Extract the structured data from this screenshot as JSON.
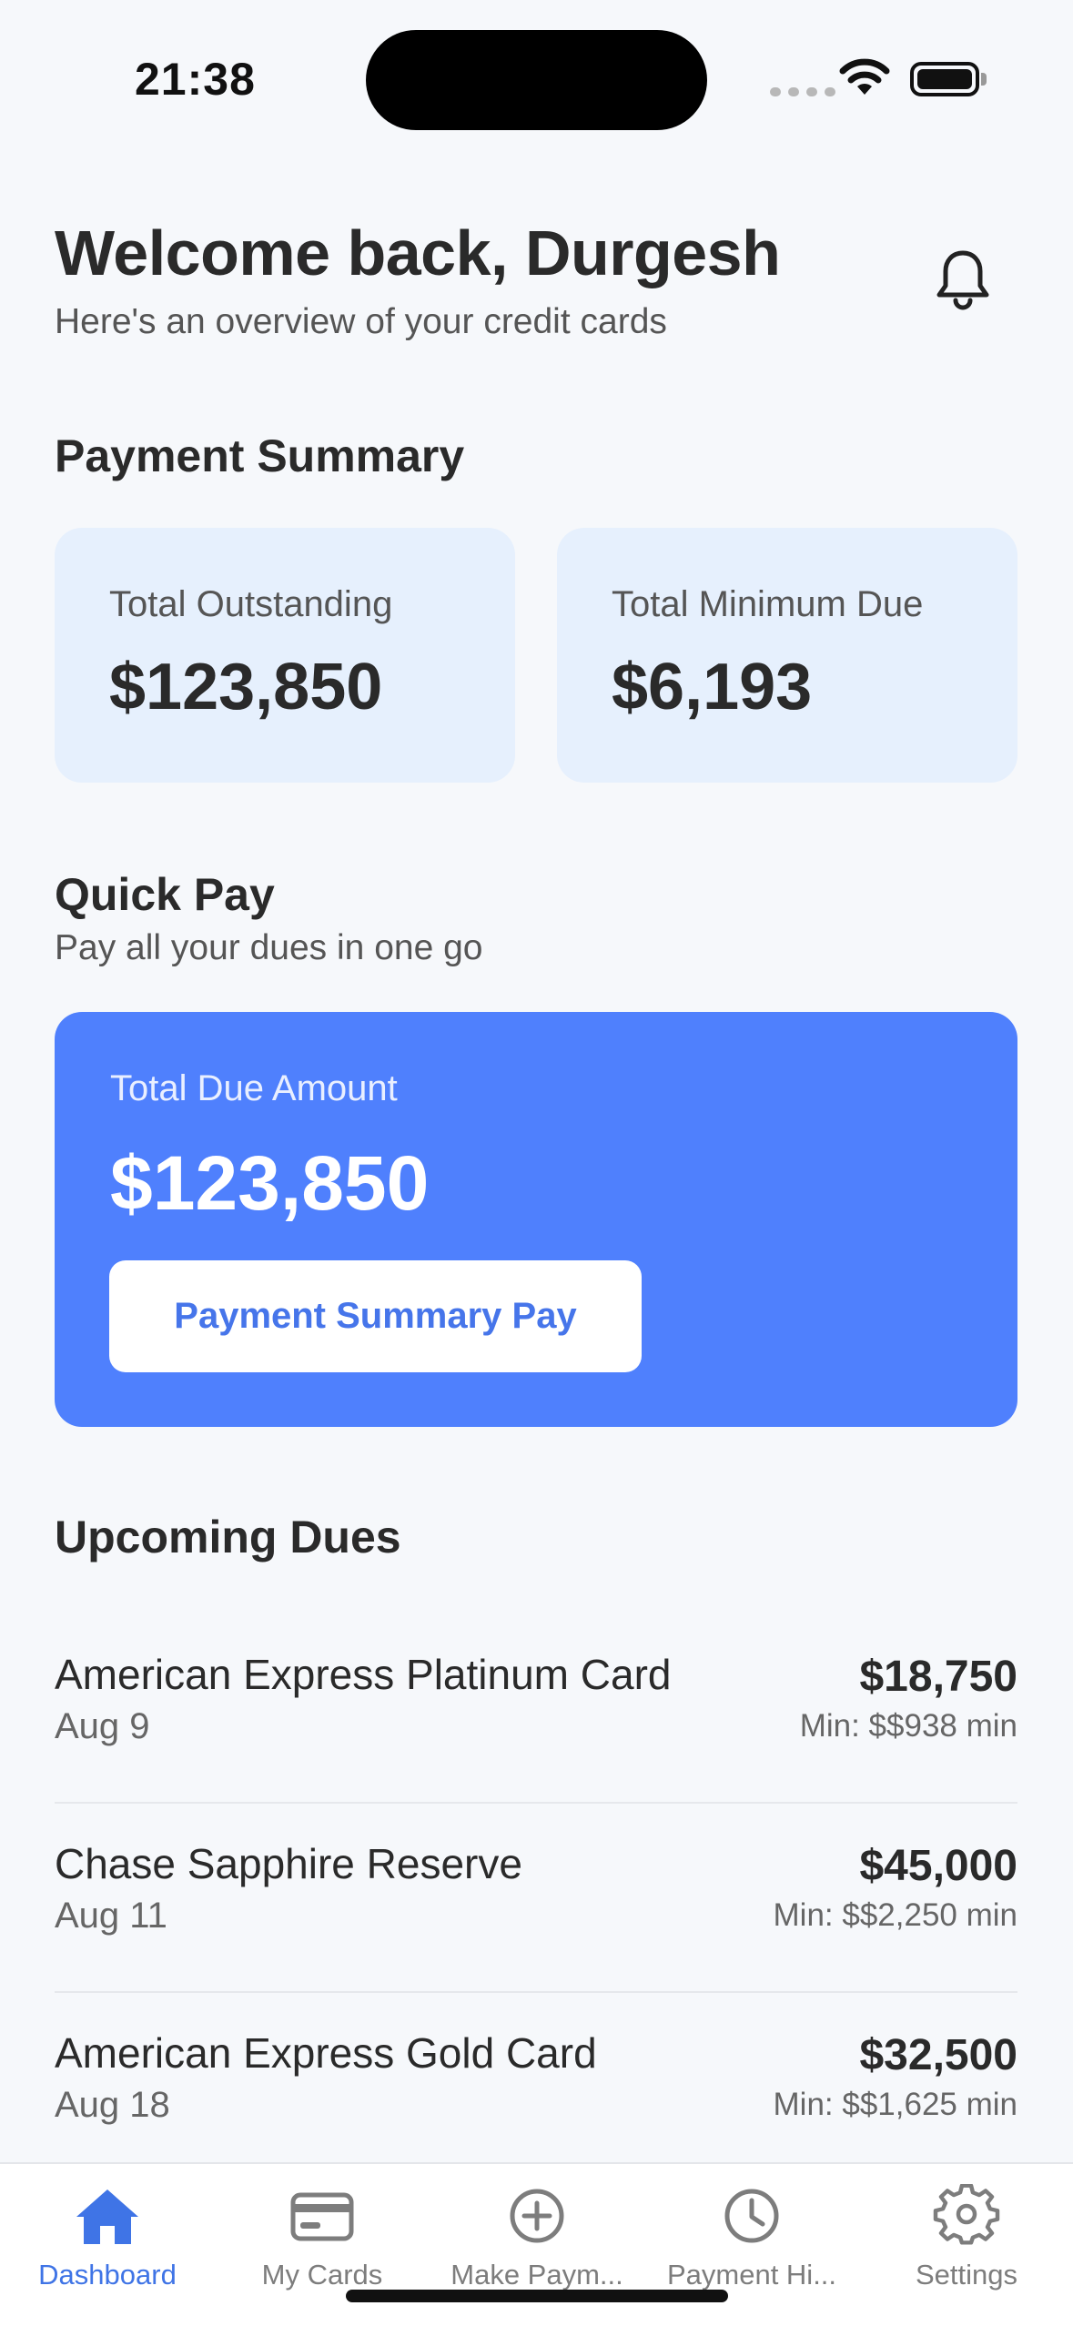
{
  "status_bar": {
    "time": "21:38"
  },
  "header": {
    "title": "Welcome back, Durgesh",
    "subtitle": "Here's an overview of your credit cards"
  },
  "payment_summary": {
    "title": "Payment Summary",
    "cards": [
      {
        "label": "Total Outstanding",
        "value": "$123,850"
      },
      {
        "label": "Total Minimum Due",
        "value": "$6,193"
      }
    ]
  },
  "quick_pay": {
    "title": "Quick Pay",
    "subtitle": "Pay all your dues in one go",
    "label": "Total Due Amount",
    "amount": "$123,850",
    "button_label": "Payment Summary Pay"
  },
  "upcoming_dues": {
    "title": "Upcoming Dues",
    "items": [
      {
        "name": "American Express Platinum Card",
        "date": "Aug 9",
        "amount": "$18,750",
        "min": "Min: $$938 min"
      },
      {
        "name": "Chase Sapphire Reserve",
        "date": "Aug 11",
        "amount": "$45,000",
        "min": "Min: $$2,250 min"
      },
      {
        "name": "American Express Gold Card",
        "date": "Aug 18",
        "amount": "$32,500",
        "min": "Min: $$1,625 min"
      }
    ]
  },
  "tab_bar": {
    "tabs": [
      {
        "label": "Dashboard",
        "icon": "house-icon",
        "active": true
      },
      {
        "label": "My Cards",
        "icon": "credit-card-icon",
        "active": false
      },
      {
        "label": "Make Paym...",
        "icon": "plus-circle-icon",
        "active": false
      },
      {
        "label": "Payment Hi...",
        "icon": "clock-icon",
        "active": false
      },
      {
        "label": "Settings",
        "icon": "gear-icon",
        "active": false
      }
    ]
  },
  "colors": {
    "accent": "#4f80fd",
    "active_tab": "#3f74e6",
    "summary_card_bg": "#e6f0fd",
    "background": "#f6f8fb"
  }
}
